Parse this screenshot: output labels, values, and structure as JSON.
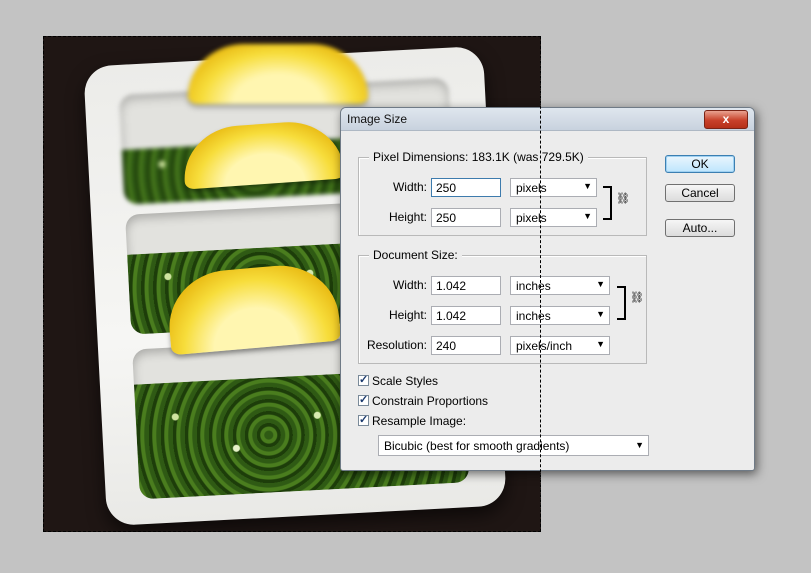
{
  "dialog": {
    "title": "Image Size",
    "close_label": "x",
    "pixel_dimensions": {
      "legend": "Pixel Dimensions:",
      "summary": "183.1K (was 729.5K)",
      "width_label": "Width:",
      "width_value": "250",
      "width_unit": "pixels",
      "height_label": "Height:",
      "height_value": "250",
      "height_unit": "pixels"
    },
    "document_size": {
      "legend": "Document Size:",
      "width_label": "Width:",
      "width_value": "1.042",
      "width_unit": "inches",
      "height_label": "Height:",
      "height_value": "1.042",
      "height_unit": "inches",
      "resolution_label": "Resolution:",
      "resolution_value": "240",
      "resolution_unit": "pixels/inch"
    },
    "options": {
      "scale_styles": {
        "label": "Scale Styles",
        "checked": true
      },
      "constrain_proportions": {
        "label": "Constrain Proportions",
        "checked": true
      },
      "resample_image": {
        "label": "Resample Image:",
        "checked": true
      },
      "resample_method": "Bicubic (best for smooth gradients)"
    },
    "buttons": {
      "ok": "OK",
      "cancel": "Cancel",
      "auto": "Auto..."
    }
  },
  "icons": {
    "chain_link": "chain-link-icon",
    "dropdown_arrow": "chevron-down-icon",
    "check": "checkmark-icon"
  },
  "colors": {
    "background": "#c3c3c3",
    "dialog_bg": "#ececec",
    "close_red": "#c8412a",
    "photo_bg": "#1f1614"
  }
}
